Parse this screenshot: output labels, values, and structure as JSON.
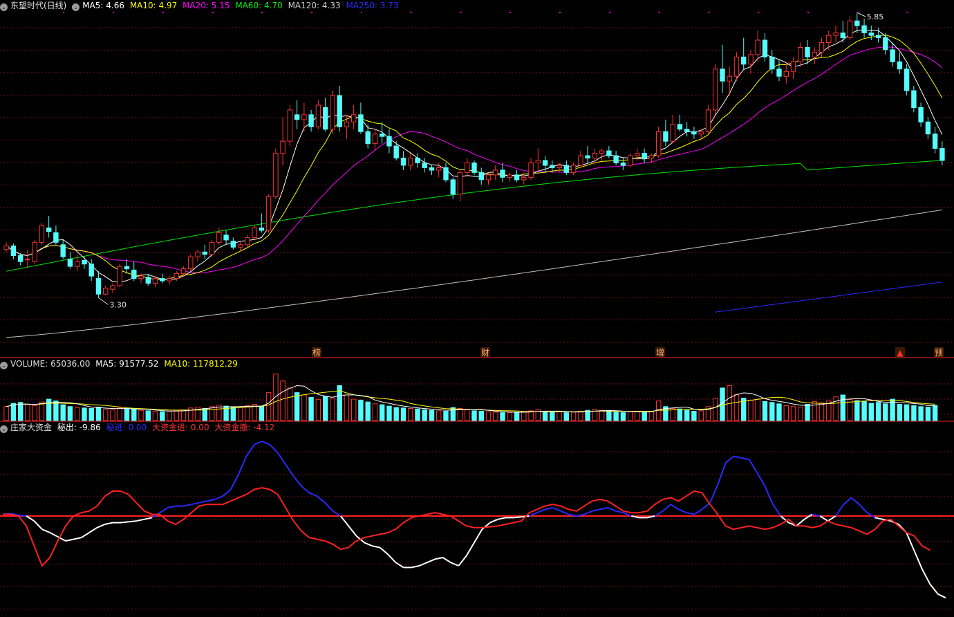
{
  "colors": {
    "up": "#ff3232",
    "down": "#54fcfc",
    "ma5": "#ffffff",
    "ma10": "#ffff00",
    "ma20": "#ff00ff",
    "ma60": "#00e600",
    "ma120": "#c0c0c0",
    "ma250": "#2a2aff",
    "grid": "#7a1010",
    "divider": "#c81e1e"
  },
  "price_header": {
    "toggle_icon": "chevron-down-icon",
    "title": "东望时代(日线)",
    "ma5": "MA5: 4.66",
    "ma10": "MA10: 4.97",
    "ma20": "MA20: 5.15",
    "ma60": "MA60: 4.70",
    "ma120": "MA120: 4.33",
    "ma250": "MA250: 3.73"
  },
  "volume_header": {
    "toggle_icon": "chevron-down-icon",
    "volume": "VOLUME: 65036.00",
    "ma5": "MA5: 91577.52",
    "ma10": "MA10: 117812.29"
  },
  "indicator_header": {
    "toggle_icon": "chevron-down-icon",
    "name": "庄家大资金",
    "out": "秘出: -9.86",
    "in": "秘进: 0.00",
    "big_in": "大资金进: 0.00",
    "big_out": "大资金撤: -4.12"
  },
  "chart_data": [
    {
      "type": "candlestick",
      "title": "东望时代(日线)",
      "ylim": [
        3.2,
        5.97
      ],
      "price_high_label": "5.85",
      "price_low_label": "3.30",
      "markers": [
        {
          "label": "榜",
          "x": 458
        },
        {
          "label": "财",
          "x": 702
        },
        {
          "label": "增",
          "x": 955
        },
        {
          "label": "▲",
          "x": 1302
        },
        {
          "label": "预",
          "x": 1358
        }
      ],
      "ohlc": [
        [
          4.0,
          4.06,
          3.98,
          4.03
        ],
        [
          4.03,
          4.05,
          3.92,
          3.95
        ],
        [
          3.95,
          3.97,
          3.87,
          3.9
        ],
        [
          3.92,
          4.0,
          3.85,
          3.92
        ],
        [
          3.9,
          4.08,
          3.88,
          4.06
        ],
        [
          4.06,
          4.22,
          4.04,
          4.2
        ],
        [
          4.18,
          4.28,
          4.1,
          4.15
        ],
        [
          4.14,
          4.2,
          4.04,
          4.06
        ],
        [
          4.04,
          4.08,
          3.92,
          3.94
        ],
        [
          3.92,
          3.98,
          3.84,
          3.86
        ],
        [
          3.86,
          3.96,
          3.82,
          3.9
        ],
        [
          3.91,
          3.94,
          3.84,
          3.88
        ],
        [
          3.88,
          3.92,
          3.74,
          3.78
        ],
        [
          3.76,
          3.82,
          3.6,
          3.63
        ],
        [
          3.63,
          3.7,
          3.62,
          3.68
        ],
        [
          3.67,
          3.72,
          3.64,
          3.7
        ],
        [
          3.7,
          3.88,
          3.69,
          3.86
        ],
        [
          3.86,
          3.92,
          3.8,
          3.84
        ],
        [
          3.83,
          3.9,
          3.74,
          3.76
        ],
        [
          3.76,
          3.8,
          3.72,
          3.78
        ],
        [
          3.77,
          3.8,
          3.7,
          3.72
        ],
        [
          3.72,
          3.78,
          3.69,
          3.76
        ],
        [
          3.76,
          3.8,
          3.72,
          3.74
        ],
        [
          3.74,
          3.78,
          3.71,
          3.76
        ],
        [
          3.76,
          3.82,
          3.74,
          3.8
        ],
        [
          3.8,
          3.86,
          3.78,
          3.84
        ],
        [
          3.84,
          3.96,
          3.82,
          3.94
        ],
        [
          3.94,
          4.0,
          3.9,
          3.98
        ],
        [
          3.98,
          4.04,
          3.92,
          3.96
        ],
        [
          3.96,
          4.08,
          3.94,
          4.06
        ],
        [
          4.06,
          4.18,
          4.04,
          4.14
        ],
        [
          4.12,
          4.16,
          4.04,
          4.08
        ],
        [
          4.07,
          4.1,
          4.0,
          4.02
        ],
        [
          4.02,
          4.06,
          3.98,
          4.04
        ],
        [
          4.04,
          4.12,
          4.02,
          4.1
        ],
        [
          4.1,
          4.2,
          4.08,
          4.18
        ],
        [
          4.18,
          4.3,
          4.14,
          4.16
        ],
        [
          4.16,
          4.46,
          4.14,
          4.44
        ],
        [
          4.44,
          4.84,
          4.42,
          4.8
        ],
        [
          4.8,
          5.1,
          4.7,
          4.9
        ],
        [
          4.9,
          5.2,
          4.86,
          5.16
        ],
        [
          5.12,
          5.24,
          5.0,
          5.08
        ],
        [
          5.08,
          5.22,
          4.98,
          5.12
        ],
        [
          5.12,
          5.16,
          4.98,
          5.02
        ],
        [
          5.02,
          5.24,
          5.0,
          5.2
        ],
        [
          5.18,
          5.26,
          4.98,
          5.0
        ],
        [
          5.0,
          5.32,
          4.96,
          5.28
        ],
        [
          5.28,
          5.36,
          4.98,
          5.02
        ],
        [
          5.02,
          5.12,
          4.92,
          5.06
        ],
        [
          5.06,
          5.2,
          5.0,
          5.12
        ],
        [
          5.12,
          5.22,
          4.96,
          4.98
        ],
        [
          4.98,
          5.04,
          4.84,
          4.88
        ],
        [
          4.88,
          5.0,
          4.82,
          4.96
        ],
        [
          4.96,
          5.06,
          4.88,
          4.94
        ],
        [
          4.94,
          5.0,
          4.8,
          4.86
        ],
        [
          4.86,
          4.9,
          4.74,
          4.76
        ],
        [
          4.76,
          4.82,
          4.66,
          4.7
        ],
        [
          4.7,
          4.8,
          4.66,
          4.76
        ],
        [
          4.76,
          4.8,
          4.68,
          4.72
        ],
        [
          4.72,
          4.76,
          4.64,
          4.68
        ],
        [
          4.68,
          4.7,
          4.62,
          4.66
        ],
        [
          4.66,
          4.72,
          4.6,
          4.68
        ],
        [
          4.68,
          4.72,
          4.56,
          4.58
        ],
        [
          4.58,
          4.6,
          4.42,
          4.46
        ],
        [
          4.46,
          4.66,
          4.4,
          4.64
        ],
        [
          4.64,
          4.76,
          4.6,
          4.72
        ],
        [
          4.72,
          4.74,
          4.62,
          4.64
        ],
        [
          4.64,
          4.68,
          4.54,
          4.58
        ],
        [
          4.58,
          4.64,
          4.54,
          4.62
        ],
        [
          4.62,
          4.7,
          4.58,
          4.66
        ],
        [
          4.66,
          4.72,
          4.56,
          4.6
        ],
        [
          4.6,
          4.64,
          4.56,
          4.62
        ],
        [
          4.62,
          4.66,
          4.56,
          4.58
        ],
        [
          4.58,
          4.64,
          4.54,
          4.6
        ],
        [
          4.6,
          4.76,
          4.58,
          4.72
        ],
        [
          4.72,
          4.84,
          4.66,
          4.74
        ],
        [
          4.74,
          4.78,
          4.64,
          4.7
        ],
        [
          4.7,
          4.74,
          4.64,
          4.68
        ],
        [
          4.68,
          4.72,
          4.64,
          4.7
        ],
        [
          4.7,
          4.74,
          4.62,
          4.64
        ],
        [
          4.64,
          4.72,
          4.62,
          4.7
        ],
        [
          4.7,
          4.82,
          4.68,
          4.78
        ],
        [
          4.78,
          4.86,
          4.72,
          4.76
        ],
        [
          4.76,
          4.84,
          4.7,
          4.8
        ],
        [
          4.8,
          4.84,
          4.74,
          4.82
        ],
        [
          4.82,
          4.86,
          4.76,
          4.78
        ],
        [
          4.78,
          4.82,
          4.7,
          4.72
        ],
        [
          4.72,
          4.76,
          4.66,
          4.7
        ],
        [
          4.7,
          4.8,
          4.68,
          4.78
        ],
        [
          4.78,
          4.84,
          4.74,
          4.8
        ],
        [
          4.8,
          4.84,
          4.72,
          4.76
        ],
        [
          4.76,
          4.8,
          4.72,
          4.78
        ],
        [
          4.78,
          5.02,
          4.76,
          4.98
        ],
        [
          4.98,
          5.08,
          4.86,
          4.9
        ],
        [
          4.9,
          5.12,
          4.88,
          5.04
        ],
        [
          5.04,
          5.12,
          4.98,
          5.0
        ],
        [
          5.0,
          5.06,
          4.94,
          4.98
        ],
        [
          4.98,
          5.02,
          4.92,
          4.96
        ],
        [
          4.96,
          5.0,
          4.92,
          4.98
        ],
        [
          4.98,
          5.2,
          4.96,
          5.16
        ],
        [
          5.16,
          5.54,
          5.12,
          5.5
        ],
        [
          5.5,
          5.7,
          5.3,
          5.4
        ],
        [
          5.4,
          5.52,
          5.28,
          5.44
        ],
        [
          5.44,
          5.64,
          5.4,
          5.6
        ],
        [
          5.6,
          5.76,
          5.5,
          5.54
        ],
        [
          5.54,
          5.66,
          5.46,
          5.62
        ],
        [
          5.62,
          5.82,
          5.56,
          5.74
        ],
        [
          5.74,
          5.8,
          5.56,
          5.6
        ],
        [
          5.6,
          5.66,
          5.46,
          5.5
        ],
        [
          5.5,
          5.58,
          5.4,
          5.44
        ],
        [
          5.44,
          5.56,
          5.38,
          5.48
        ],
        [
          5.48,
          5.6,
          5.42,
          5.56
        ],
        [
          5.56,
          5.72,
          5.52,
          5.68
        ],
        [
          5.68,
          5.74,
          5.54,
          5.6
        ],
        [
          5.6,
          5.68,
          5.54,
          5.64
        ],
        [
          5.64,
          5.76,
          5.6,
          5.72
        ],
        [
          5.72,
          5.82,
          5.66,
          5.78
        ],
        [
          5.78,
          5.86,
          5.72,
          5.8
        ],
        [
          5.8,
          5.9,
          5.72,
          5.76
        ],
        [
          5.76,
          5.94,
          5.74,
          5.9
        ],
        [
          5.9,
          5.97,
          5.8,
          5.86
        ],
        [
          5.86,
          5.92,
          5.76,
          5.8
        ],
        [
          5.8,
          5.86,
          5.74,
          5.78
        ],
        [
          5.78,
          5.84,
          5.72,
          5.76
        ],
        [
          5.76,
          5.8,
          5.62,
          5.66
        ],
        [
          5.66,
          5.72,
          5.52,
          5.56
        ],
        [
          5.56,
          5.64,
          5.46,
          5.5
        ],
        [
          5.5,
          5.54,
          5.28,
          5.32
        ],
        [
          5.32,
          5.36,
          5.14,
          5.18
        ],
        [
          5.18,
          5.22,
          5.02,
          5.06
        ],
        [
          5.06,
          5.1,
          4.92,
          4.96
        ],
        [
          4.96,
          5.02,
          4.8,
          4.84
        ],
        [
          4.84,
          4.9,
          4.7,
          4.74
        ]
      ],
      "ma_window_days": {
        "ma5": 5,
        "ma10": 10,
        "ma20": 20,
        "ma60": 60,
        "ma120": 120,
        "ma250": 250
      }
    },
    {
      "type": "bar",
      "title": "VOLUME",
      "ylim": [
        0,
        220000
      ],
      "values": [
        60000,
        74000,
        78000,
        70000,
        64000,
        80000,
        92000,
        84000,
        68000,
        60000,
        56000,
        54000,
        52000,
        58000,
        48000,
        46000,
        54000,
        52000,
        50000,
        44000,
        42000,
        40000,
        38000,
        40000,
        44000,
        46000,
        54000,
        58000,
        52000,
        60000,
        66000,
        62000,
        58000,
        56000,
        64000,
        70000,
        62000,
        120000,
        200000,
        170000,
        140000,
        120000,
        110000,
        100000,
        90000,
        104000,
        96000,
        150000,
        110000,
        92000,
        88000,
        80000,
        72000,
        68000,
        62000,
        56000,
        54000,
        52000,
        50000,
        46000,
        44000,
        42000,
        40000,
        56000,
        52000,
        46000,
        42000,
        40000,
        38000,
        36000,
        34000,
        34000,
        36000,
        38000,
        42000,
        46000,
        40000,
        36000,
        38000,
        34000,
        36000,
        40000,
        44000,
        48000,
        44000,
        40000,
        36000,
        34000,
        38000,
        40000,
        36000,
        38000,
        84000,
        60000,
        52000,
        50000,
        44000,
        40000,
        42000,
        60000,
        96000,
        140000,
        150000,
        112000,
        96000,
        88000,
        92000,
        82000,
        78000,
        72000,
        64000,
        60000,
        58000,
        70000,
        82000,
        76000,
        84000,
        102000,
        110000,
        90000,
        86000,
        82000,
        74000,
        78000,
        72000,
        92000,
        70000,
        68000,
        64000,
        60000,
        58000,
        65036
      ]
    },
    {
      "type": "line",
      "title": "庄家大资金",
      "ylim": [
        -12,
        10
      ],
      "baseline": 0,
      "series": [
        {
          "name": "秘出",
          "values": [
            0.2,
            0.3,
            0.1,
            0.0,
            -0.6,
            -1.6,
            -2.0,
            -2.5,
            -3.0,
            -2.8,
            -2.6,
            -2.0,
            -1.4,
            -1.0,
            -0.8,
            -0.8,
            -0.7,
            -0.6,
            -0.4,
            -0.2,
            0.4,
            1.0,
            1.2,
            1.2,
            1.4,
            1.6,
            1.8,
            2.0,
            2.4,
            3.2,
            5.0,
            7.2,
            8.6,
            9.0,
            8.6,
            7.6,
            6.2,
            4.8,
            3.6,
            2.8,
            2.4,
            1.6,
            0.6,
            0.0,
            -1.2,
            -2.4,
            -3.2,
            -3.6,
            -3.8,
            -4.6,
            -5.6,
            -6.2,
            -6.2,
            -6.0,
            -5.6,
            -5.2,
            -5.0,
            -5.6,
            -6.0,
            -4.8,
            -3.2,
            -1.6,
            -0.8,
            -0.4,
            -0.2,
            -0.2,
            -0.1,
            0.0,
            0.4,
            0.8,
            1.0,
            0.6,
            0.2,
            0.0,
            0.2,
            0.6,
            0.8,
            1.0,
            0.6,
            0.4,
            0.0,
            -0.2,
            -0.2,
            0.0,
            0.6,
            1.4,
            0.8,
            0.4,
            0.2,
            0.8,
            1.6,
            3.8,
            6.4,
            7.2,
            7.0,
            6.8,
            5.2,
            3.6,
            1.4,
            0.0,
            -0.8,
            -1.2,
            -0.4,
            0.2,
            0.0,
            -0.6,
            0.0,
            1.4,
            2.2,
            1.4,
            0.4,
            -0.2,
            -0.4,
            -0.6,
            -1.0,
            -2.0,
            -4.2,
            -6.4,
            -8.2,
            -9.4,
            -9.86
          ]
        },
        {
          "name": "大资金撤",
          "values": [
            0.2,
            0.2,
            0.0,
            -1.2,
            -3.6,
            -6.0,
            -5.0,
            -3.0,
            -1.2,
            0.0,
            0.4,
            0.6,
            1.2,
            2.4,
            3.0,
            3.0,
            2.6,
            1.6,
            0.6,
            0.2,
            0.2,
            -0.6,
            -1.0,
            -0.4,
            0.4,
            1.2,
            1.4,
            1.4,
            1.4,
            1.8,
            2.2,
            2.6,
            3.2,
            3.4,
            3.2,
            2.6,
            1.0,
            -0.6,
            -1.8,
            -2.6,
            -2.8,
            -3.0,
            -3.4,
            -4.0,
            -3.8,
            -3.0,
            -2.6,
            -2.4,
            -2.2,
            -2.0,
            -1.6,
            -0.8,
            -0.2,
            0.0,
            0.2,
            0.4,
            0.2,
            0.0,
            -0.6,
            -1.2,
            -1.4,
            -1.4,
            -1.3,
            -1.2,
            -1.0,
            -0.8,
            -0.6,
            0.4,
            0.8,
            1.2,
            1.4,
            1.2,
            0.8,
            0.6,
            1.2,
            1.8,
            2.0,
            1.8,
            1.2,
            0.6,
            0.4,
            0.4,
            0.6,
            1.4,
            2.0,
            2.2,
            1.8,
            2.4,
            3.0,
            2.8,
            1.4,
            0.2,
            -1.2,
            -1.6,
            -1.4,
            -1.2,
            -1.4,
            -1.6,
            -1.4,
            -1.0,
            -0.4,
            -1.2,
            -1.2,
            -1.4,
            -1.2,
            -0.6,
            -1.0,
            -1.2,
            -1.4,
            -1.8,
            -2.2,
            -1.6,
            -0.6,
            -0.4,
            -1.2,
            -2.0,
            -2.4,
            -3.6,
            -4.12
          ]
        }
      ],
      "secret_in": 0.0,
      "big_in": 0.0
    }
  ]
}
